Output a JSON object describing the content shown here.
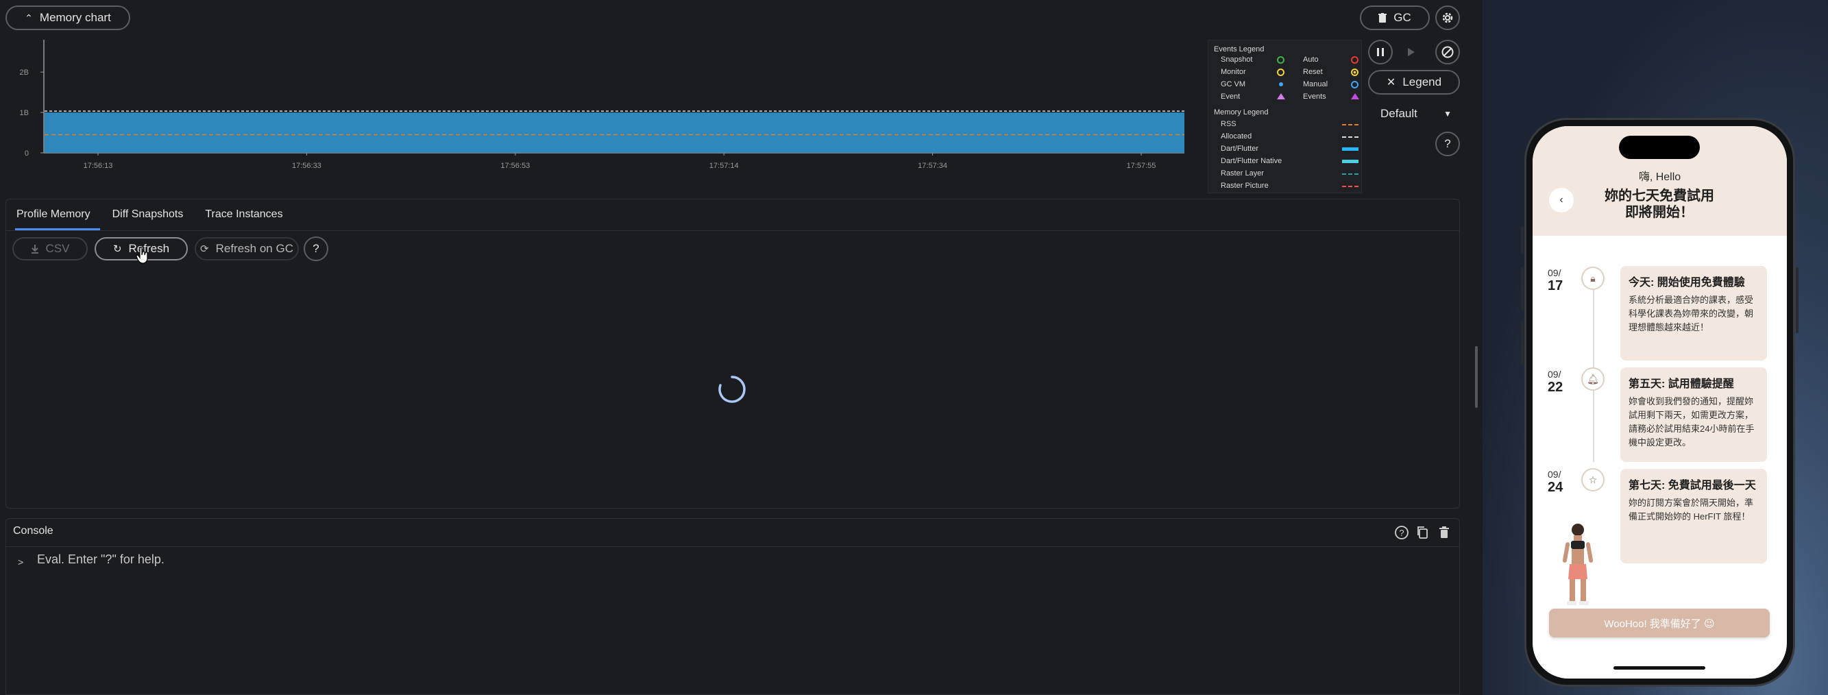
{
  "devtools": {
    "memory_chart_toggle": "Memory chart",
    "gc_button": "GC",
    "legend_button": "Legend",
    "mode_select": {
      "value": "Default"
    },
    "tabs": [
      {
        "label": "Profile Memory",
        "active": true
      },
      {
        "label": "Diff Snapshots",
        "active": false
      },
      {
        "label": "Trace Instances",
        "active": false
      }
    ],
    "toolbar": {
      "csv_label": "CSV",
      "refresh_label": "Refresh",
      "refresh_on_gc_label": "Refresh on GC"
    },
    "console": {
      "title": "Console",
      "prompt": ">",
      "placeholder": "Eval. Enter \"?\" for help."
    },
    "legend": {
      "events_title": "Events Legend",
      "events": [
        {
          "label": "Snapshot",
          "color": "#3bb54a",
          "shape": "ring"
        },
        {
          "label": "Auto",
          "color": "#e53935",
          "shape": "ring"
        },
        {
          "label": "Monitor",
          "color": "#f4d03f",
          "shape": "ring"
        },
        {
          "label": "Reset",
          "color": "#f4d03f",
          "shape": "dot-ring"
        },
        {
          "label": "GC VM",
          "color": "#42a5f5",
          "shape": "dot"
        },
        {
          "label": "Manual",
          "color": "#42a5f5",
          "shape": "ring"
        },
        {
          "label": "Event",
          "color": "#d67be8",
          "shape": "triangle"
        },
        {
          "label": "Events",
          "color": "#c04de0",
          "shape": "triangle"
        }
      ],
      "memory_title": "Memory Legend",
      "memory": [
        {
          "label": "RSS",
          "color": "#e67e22",
          "style": "dashed"
        },
        {
          "label": "Allocated",
          "color": "#dddddd",
          "style": "dashed"
        },
        {
          "label": "Dart/Flutter",
          "color": "#29b6f6",
          "style": "solid"
        },
        {
          "label": "Dart/Flutter Native",
          "color": "#4dd0e1",
          "style": "solid"
        },
        {
          "label": "Raster Layer",
          "color": "#26a69a",
          "style": "dashed"
        },
        {
          "label": "Raster Picture",
          "color": "#ef5350",
          "style": "dashed"
        }
      ]
    }
  },
  "chart_data": {
    "type": "area",
    "title": "",
    "xlabel": "",
    "ylabel": "",
    "y_tick_labels": [
      "0",
      "1B",
      "2B"
    ],
    "x_tick_labels": [
      "17:56:13",
      "17:56:33",
      "17:56:53",
      "17:57:14",
      "17:57:34",
      "17:57:55"
    ],
    "ylim": [
      0,
      2.8
    ],
    "x": [
      "17:56:13",
      "17:56:33",
      "17:56:53",
      "17:57:14",
      "17:57:34",
      "17:57:55"
    ],
    "series": [
      {
        "name": "Dart/Flutter",
        "values": [
          1.0,
          1.0,
          1.0,
          1.0,
          1.0,
          1.0
        ],
        "color": "#2f88bb"
      },
      {
        "name": "RSS",
        "values": [
          0.45,
          0.45,
          0.45,
          0.45,
          0.45,
          0.45
        ],
        "color": "#e67e22"
      },
      {
        "name": "Allocated",
        "values": [
          1.0,
          1.0,
          1.0,
          1.0,
          1.0,
          1.0
        ],
        "color": "#dddddd"
      }
    ],
    "grid": false,
    "legend": "right"
  },
  "app": {
    "greeting": "嗨, Hello",
    "heading_line1": "妳的七天免費試用",
    "heading_line2": "即將開始！",
    "timeline": [
      {
        "month": "09/",
        "day": "17",
        "icon": "lock-icon",
        "title": "今天: 開始使用免費體驗",
        "body": "系統分析最適合妳的課表，感受科學化課表為妳帶來的改變，朝理想體態越來越近！"
      },
      {
        "month": "09/",
        "day": "22",
        "icon": "bell-icon",
        "title": "第五天: 試用體驗提醒",
        "body": "妳會收到我們發的通知，提醒妳試用剩下兩天，如需更改方案，請務必於試用結束24小時前在手機中設定更改。"
      },
      {
        "month": "09/",
        "day": "24",
        "icon": "star-icon",
        "title": "第七天: 免費試用最後一天",
        "body": "妳的訂閱方案會於隔天開始，準備正式開始妳的 HerFIT 旅程！"
      }
    ],
    "cta": "WooHoo! 我準備好了 😉"
  }
}
